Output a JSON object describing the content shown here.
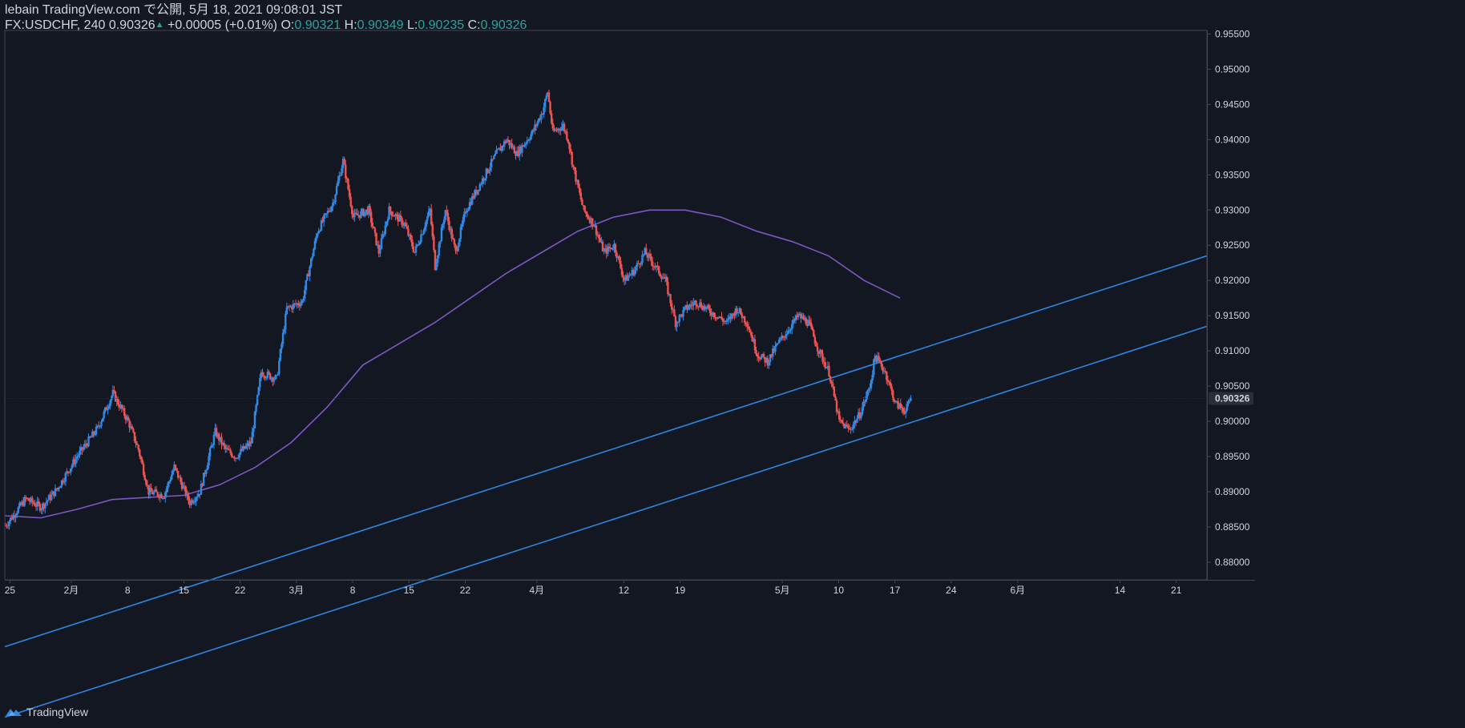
{
  "header": {
    "line1": "lebain TradingView.com で公開, 5月 18, 2021 09:08:01 JST",
    "symbol": "FX:USDCHF, 240",
    "last": "0.90326",
    "change": "+0.00005 (+0.01%)",
    "open_label": "O:",
    "open": "0.90321",
    "high_label": "H:",
    "high": "0.90349",
    "low_label": "L:",
    "low": "0.90235",
    "close_label": "C:",
    "close": "0.90326"
  },
  "footer": {
    "brand": "TradingView",
    "logo_icon": "tradingview-logo-icon"
  },
  "colors": {
    "background": "#131722",
    "up": "#2f8ae6",
    "down": "#ef5350",
    "moving_average": "#7e57c2",
    "channel": "#2e86de",
    "axis_border": "#434651"
  },
  "chart_data": {
    "type": "candlestick",
    "title": "FX:USDCHF, 240",
    "xlabel": "",
    "ylabel": "",
    "ylim": [
      0.8775,
      0.9555
    ],
    "y_ticks": [
      "0.88000",
      "0.88500",
      "0.89000",
      "0.89500",
      "0.90000",
      "0.90500",
      "0.91000",
      "0.91500",
      "0.92000",
      "0.92500",
      "0.93000",
      "0.93500",
      "0.94000",
      "0.94500",
      "0.95000",
      "0.95500"
    ],
    "x_ticks": [
      "25",
      "2月",
      "8",
      "15",
      "22",
      "3月",
      "8",
      "15",
      "22",
      "4月",
      "12",
      "19",
      "5月",
      "10",
      "17",
      "24",
      "6月",
      "14",
      "21"
    ],
    "last_price_label": "0.90326",
    "grid": false,
    "series": [
      {
        "kind": "price_path",
        "points": [
          [
            0,
            0.8852
          ],
          [
            4,
            0.889
          ],
          [
            7,
            0.8878
          ],
          [
            10,
            0.8903
          ],
          [
            14,
            0.895
          ],
          [
            18,
            0.899
          ],
          [
            21,
            0.904
          ],
          [
            24,
            0.9
          ],
          [
            26,
            0.896
          ],
          [
            28,
            0.89
          ],
          [
            31,
            0.8895
          ],
          [
            33,
            0.8935
          ],
          [
            36,
            0.8885
          ],
          [
            38,
            0.89
          ],
          [
            41,
            0.8985
          ],
          [
            43,
            0.896
          ],
          [
            45,
            0.895
          ],
          [
            48,
            0.897
          ],
          [
            50,
            0.907
          ],
          [
            53,
            0.906
          ],
          [
            55,
            0.916
          ],
          [
            58,
            0.917
          ],
          [
            61,
            0.927
          ],
          [
            64,
            0.931
          ],
          [
            66,
            0.937
          ],
          [
            68,
            0.929
          ],
          [
            71,
            0.93
          ],
          [
            73,
            0.924
          ],
          [
            75,
            0.93
          ],
          [
            78,
            0.928
          ],
          [
            80,
            0.924
          ],
          [
            83,
            0.93
          ],
          [
            84,
            0.922
          ],
          [
            86,
            0.93
          ],
          [
            88,
            0.924
          ],
          [
            90,
            0.93
          ],
          [
            93,
            0.934
          ],
          [
            96,
            0.938
          ],
          [
            98,
            0.94
          ],
          [
            100,
            0.938
          ],
          [
            103,
            0.941
          ],
          [
            105,
            0.944
          ],
          [
            106,
            0.9468
          ],
          [
            107,
            0.941
          ],
          [
            109,
            0.942
          ],
          [
            110,
            0.94
          ],
          [
            111,
            0.936
          ],
          [
            113,
            0.93
          ],
          [
            115,
            0.928
          ],
          [
            117,
            0.924
          ],
          [
            119,
            0.925
          ],
          [
            121,
            0.92
          ],
          [
            123,
            0.9215
          ],
          [
            125,
            0.924
          ],
          [
            127,
            0.922
          ],
          [
            129,
            0.92
          ],
          [
            131,
            0.914
          ],
          [
            133,
            0.916
          ],
          [
            135,
            0.917
          ],
          [
            137,
            0.916
          ],
          [
            139,
            0.915
          ],
          [
            141,
            0.914
          ],
          [
            143,
            0.916
          ],
          [
            145,
            0.914
          ],
          [
            147,
            0.9095
          ],
          [
            149,
            0.9085
          ],
          [
            151,
            0.911
          ],
          [
            153,
            0.913
          ],
          [
            155,
            0.915
          ],
          [
            157,
            0.914
          ],
          [
            159,
            0.91
          ],
          [
            161,
            0.907
          ],
          [
            163,
            0.9
          ],
          [
            165,
            0.8988
          ],
          [
            167,
            0.901
          ],
          [
            169,
            0.905
          ],
          [
            170,
            0.9093
          ],
          [
            172,
            0.907
          ],
          [
            174,
            0.9025
          ],
          [
            176,
            0.9015
          ],
          [
            177,
            0.9033
          ]
        ]
      },
      {
        "name": "",
        "kind": "moving_average",
        "points": [
          [
            0,
            0.8866
          ],
          [
            7,
            0.8863
          ],
          [
            14,
            0.8875
          ],
          [
            21,
            0.8889
          ],
          [
            28,
            0.8892
          ],
          [
            35,
            0.8895
          ],
          [
            42,
            0.891
          ],
          [
            49,
            0.8935
          ],
          [
            56,
            0.897
          ],
          [
            63,
            0.902
          ],
          [
            70,
            0.908
          ],
          [
            77,
            0.911
          ],
          [
            84,
            0.914
          ],
          [
            91,
            0.9175
          ],
          [
            98,
            0.921
          ],
          [
            105,
            0.924
          ],
          [
            112,
            0.927
          ],
          [
            119,
            0.929
          ],
          [
            126,
            0.93
          ],
          [
            133,
            0.93
          ],
          [
            140,
            0.929
          ],
          [
            147,
            0.927
          ],
          [
            154,
            0.9255
          ],
          [
            161,
            0.9235
          ],
          [
            168,
            0.92
          ],
          [
            175,
            0.9175
          ]
        ]
      },
      {
        "name": "",
        "kind": "trendline",
        "points": [
          [
            0,
            0.868
          ],
          [
            235,
            0.9235
          ]
        ]
      },
      {
        "name": "",
        "kind": "trendline",
        "points": [
          [
            0,
            0.858
          ],
          [
            235,
            0.9135
          ]
        ]
      }
    ]
  }
}
